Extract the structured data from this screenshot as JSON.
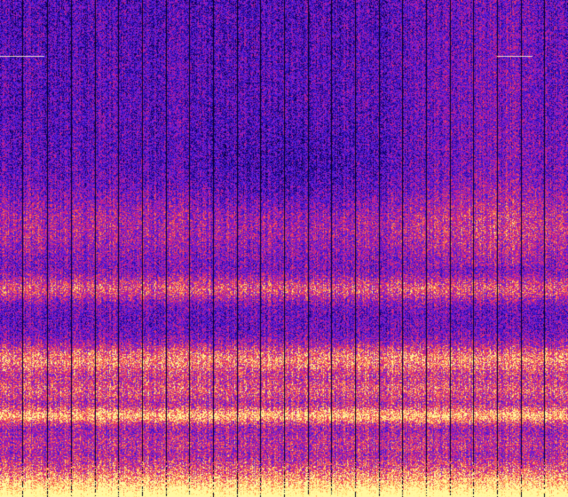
{
  "image": {
    "kind": "spectrogram",
    "colormap": "plasma-like",
    "palette": [
      "#0a0040",
      "#2a00b0",
      "#4b1de0",
      "#8a1fd0",
      "#c2168f",
      "#ec3a5a",
      "#ff7a3a",
      "#ffd36a",
      "#fff59a"
    ],
    "background_noise_speckle": true,
    "vertical_gap_lines": true,
    "dominant_colors": {
      "top_region": "#2b16c8",
      "middle_band": "#c0188f",
      "bright_bands": "#fff59a",
      "gap_lines": "#0a0020"
    }
  }
}
